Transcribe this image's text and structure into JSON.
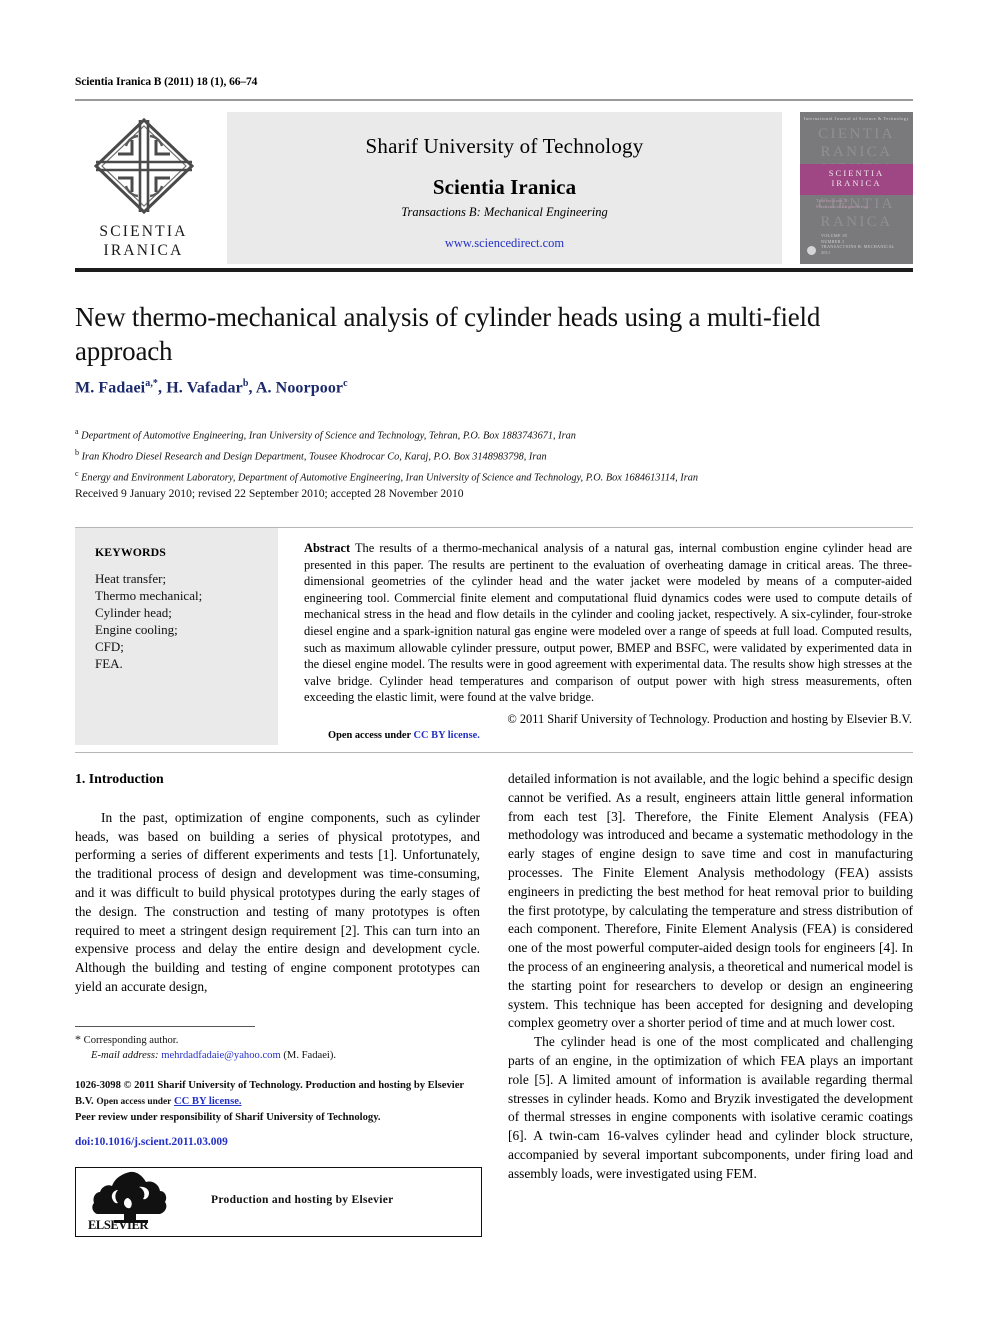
{
  "running_head": "Scientia Iranica B (2011) 18 (1), 66–74",
  "journal_header": {
    "logo_text_line1": "SCIENTIA",
    "logo_text_line2": "IRANICA",
    "university": "Sharif University of Technology",
    "journal": "Scientia Iranica",
    "transactions": "Transactions B: Mechanical Engineering",
    "sciencedirect": "www.sciencedirect.com",
    "link_color": "#2430c7",
    "cover": {
      "top_line": "International Journal of Science & Technology",
      "band_line1": "SCIENTIA",
      "band_line2": "IRANICA",
      "band_color": "#9f4784",
      "sub_line1": "Transactions B:",
      "sub_line2": "Mechanical Engineering",
      "ghost_text": "CIENTIA\nRANICA\nCIENTIA\nRANICA\nCIENTIA\nRANICA",
      "foot_line1": "VOLUME 18",
      "foot_line2": "NUMBER 1",
      "foot_line3": "TRANSACTIONS B: MECHANICAL",
      "foot_line4": "2011"
    }
  },
  "article": {
    "title": "New thermo-mechanical analysis of cylinder heads using a multi-field approach",
    "authors_html": "M. Fadaei<sup>a,*</sup>, H. Vafadar<sup>b</sup>, A. Noorpoor<sup>c</sup>",
    "affiliations": [
      {
        "marker": "a",
        "text": "Department of Automotive Engineering, Iran University of Science and Technology, Tehran, P.O. Box 1883743671, Iran"
      },
      {
        "marker": "b",
        "text": "Iran Khodro Diesel Research and Design Department, Tousee Khodrocar Co, Karaj, P.O. Box 3148983798, Iran"
      },
      {
        "marker": "c",
        "text": "Energy and Environment Laboratory, Department of Automotive Engineering, Iran University of Science and Technology, P.O. Box 1684613114, Iran"
      }
    ],
    "history": "Received 9 January 2010; revised 22 September 2010; accepted 28 November 2010"
  },
  "keywords": {
    "heading": "KEYWORDS",
    "items": [
      "Heat transfer;",
      "Thermo mechanical;",
      "Cylinder head;",
      "Engine cooling;",
      "CFD;",
      "FEA."
    ]
  },
  "abstract": {
    "lead": "Abstract",
    "text": "The results of a thermo-mechanical analysis of a natural gas, internal combustion engine cylinder head are presented in this paper. The results are pertinent to the evaluation of overheating damage in critical areas. The three-dimensional geometries of the cylinder head and the water jacket were modeled by means of a computer-aided engineering tool. Commercial finite element and computational fluid dynamics codes were used to compute details of mechanical stress in the head and flow details in the cylinder and cooling jacket, respectively. A six-cylinder, four-stroke diesel engine and a spark-ignition natural gas engine were modeled over a range of speeds at full load. Computed results, such as maximum allowable cylinder pressure, output power, BMEP and BSFC, were validated by experimented data in the diesel engine model. The results were in good agreement with experimental data. The results show high stresses at the valve bridge. Cylinder head temperatures and comparison of output power with high stress measurements, often exceeding the elastic limit, were found at the valve bridge.",
    "copyright": "© 2011 Sharif University of Technology. Production and hosting by Elsevier B.V.",
    "open_access_prefix": "Open access under",
    "open_access_link": "CC BY license."
  },
  "body": {
    "section_number_title": "1.  Introduction",
    "left_column": [
      "In the past, optimization of engine components, such as cylinder heads, was based on building a series of physical prototypes, and performing a series of different experiments and tests [1]. Unfortunately, the traditional process of design and development was time-consuming, and it was difficult to build physical prototypes during the early stages of the design. The construction and testing of many prototypes is often required to meet a stringent design requirement [2]. This can turn into an expensive process and delay the entire design and development cycle. Although the building and testing of engine component prototypes can yield an accurate design,"
    ],
    "right_column": [
      "detailed information is not available, and the logic behind a specific design cannot be verified. As a result, engineers attain little general information from each test [3]. Therefore, the Finite Element Analysis (FEA) methodology was introduced and became a systematic methodology in the early stages of engine design to save time and cost in manufacturing processes. The Finite Element Analysis methodology (FEA) assists engineers in predicting the best method for heat removal prior to building the first prototype, by calculating the temperature and stress distribution of each component. Therefore, Finite Element Analysis (FEA) is considered one of the most powerful computer-aided design tools for engineers [4]. In the process of an engineering analysis, a theoretical and numerical model is the starting point for researchers to develop or design an engineering system. This technique has been accepted for designing and developing complex geometry over a shorter period of time and at much lower cost.",
      "The cylinder head is one of the most complicated and challenging parts of an engine, in the optimization of which FEA plays an important role [5]. A limited amount of information is available regarding thermal stresses in cylinder heads. Komo and Bryzik investigated the development of thermal stresses in engine components with isolative ceramic coatings [6]. A twin-cam 16-valves cylinder head and cylinder block structure, accompanied by several important subcomponents, under firing load and assembly loads, were investigated using FEM."
    ]
  },
  "footnotes": {
    "corresponding": "Corresponding author.",
    "email_label": "E-mail address:",
    "email": "mehrdadfadaie@yahoo.com",
    "email_suffix": "(M. Fadaei).",
    "imprint_line1": "1026-3098 © 2011 Sharif University of Technology. Production and hosting by Elsevier B.V.",
    "imprint_oa_prefix": "Open access under",
    "imprint_oa_link": "CC BY license.",
    "peer_review": "Peer review under responsibility of Sharif  University of Technology.",
    "doi": "doi:10.1016/j.scient.2011.03.009"
  },
  "production_box": {
    "label": "Production and hosting by Elsevier",
    "wordmark": "ELSEVIER"
  }
}
